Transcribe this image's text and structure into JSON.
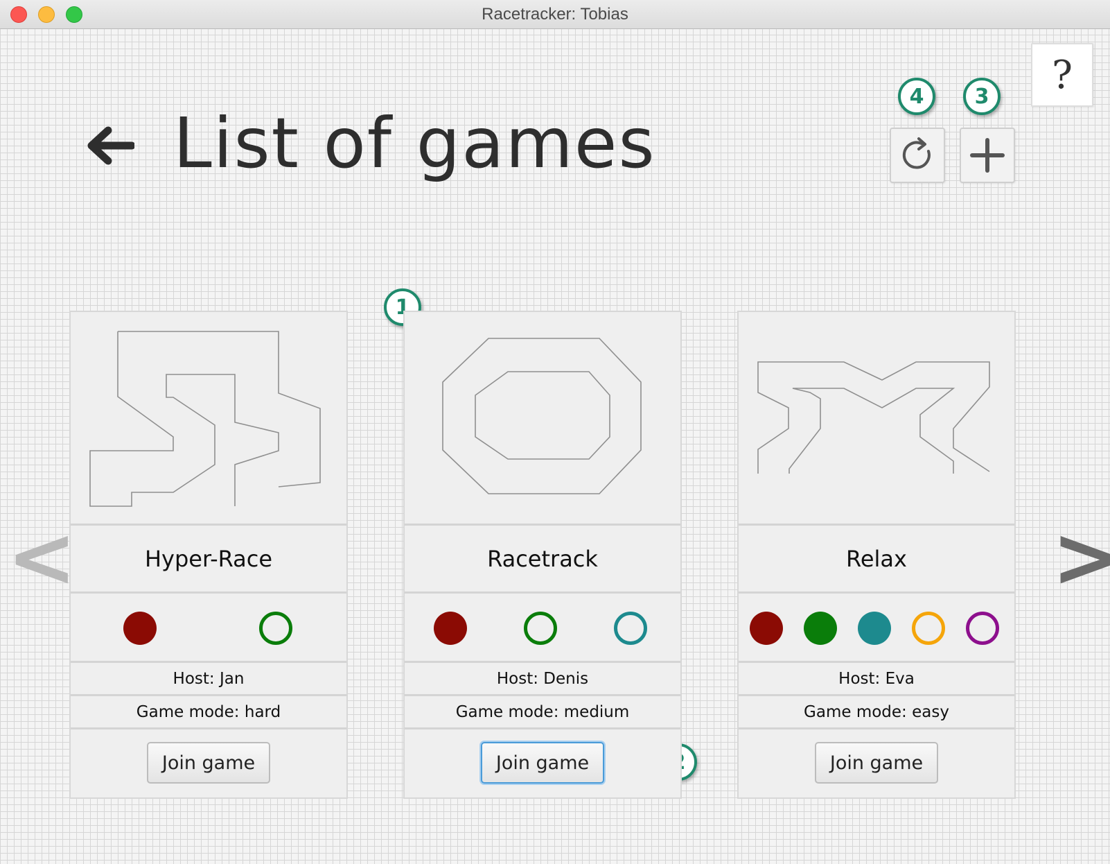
{
  "window": {
    "title": "Racetracker: Tobias"
  },
  "header": {
    "title": "List of games",
    "back_icon": "left-arrow-icon"
  },
  "toolbar": {
    "refresh_icon": "refresh-icon",
    "add_label": "+",
    "help_label": "?"
  },
  "annotations": {
    "refresh": "4",
    "add": "3",
    "card": "1",
    "join": "2",
    "color": "#1f8a6c"
  },
  "navigation": {
    "prev_label": "<",
    "next_label": ">"
  },
  "games": [
    {
      "name": "Hyper-Race",
      "host": "Host: Jan",
      "mode": "Game mode: hard",
      "join_label": "Join game",
      "players": [
        {
          "color": "#8b0b04",
          "filled": true
        },
        {
          "color": "#0a7d0a",
          "filled": false
        }
      ]
    },
    {
      "name": "Racetrack",
      "host": "Host: Denis",
      "mode": "Game mode: medium",
      "join_label": "Join game",
      "players": [
        {
          "color": "#8b0b04",
          "filled": true
        },
        {
          "color": "#0a7d0a",
          "filled": false
        },
        {
          "color": "#1d8a8e",
          "filled": false
        }
      ]
    },
    {
      "name": "Relax",
      "host": "Host: Eva",
      "mode": "Game mode: easy",
      "join_label": "Join game",
      "players": [
        {
          "color": "#8b0b04",
          "filled": true
        },
        {
          "color": "#0a7d0a",
          "filled": true
        },
        {
          "color": "#1d8a8e",
          "filled": true
        },
        {
          "color": "#f5a50a",
          "filled": false
        },
        {
          "color": "#8d0f8d",
          "filled": false
        }
      ]
    }
  ]
}
